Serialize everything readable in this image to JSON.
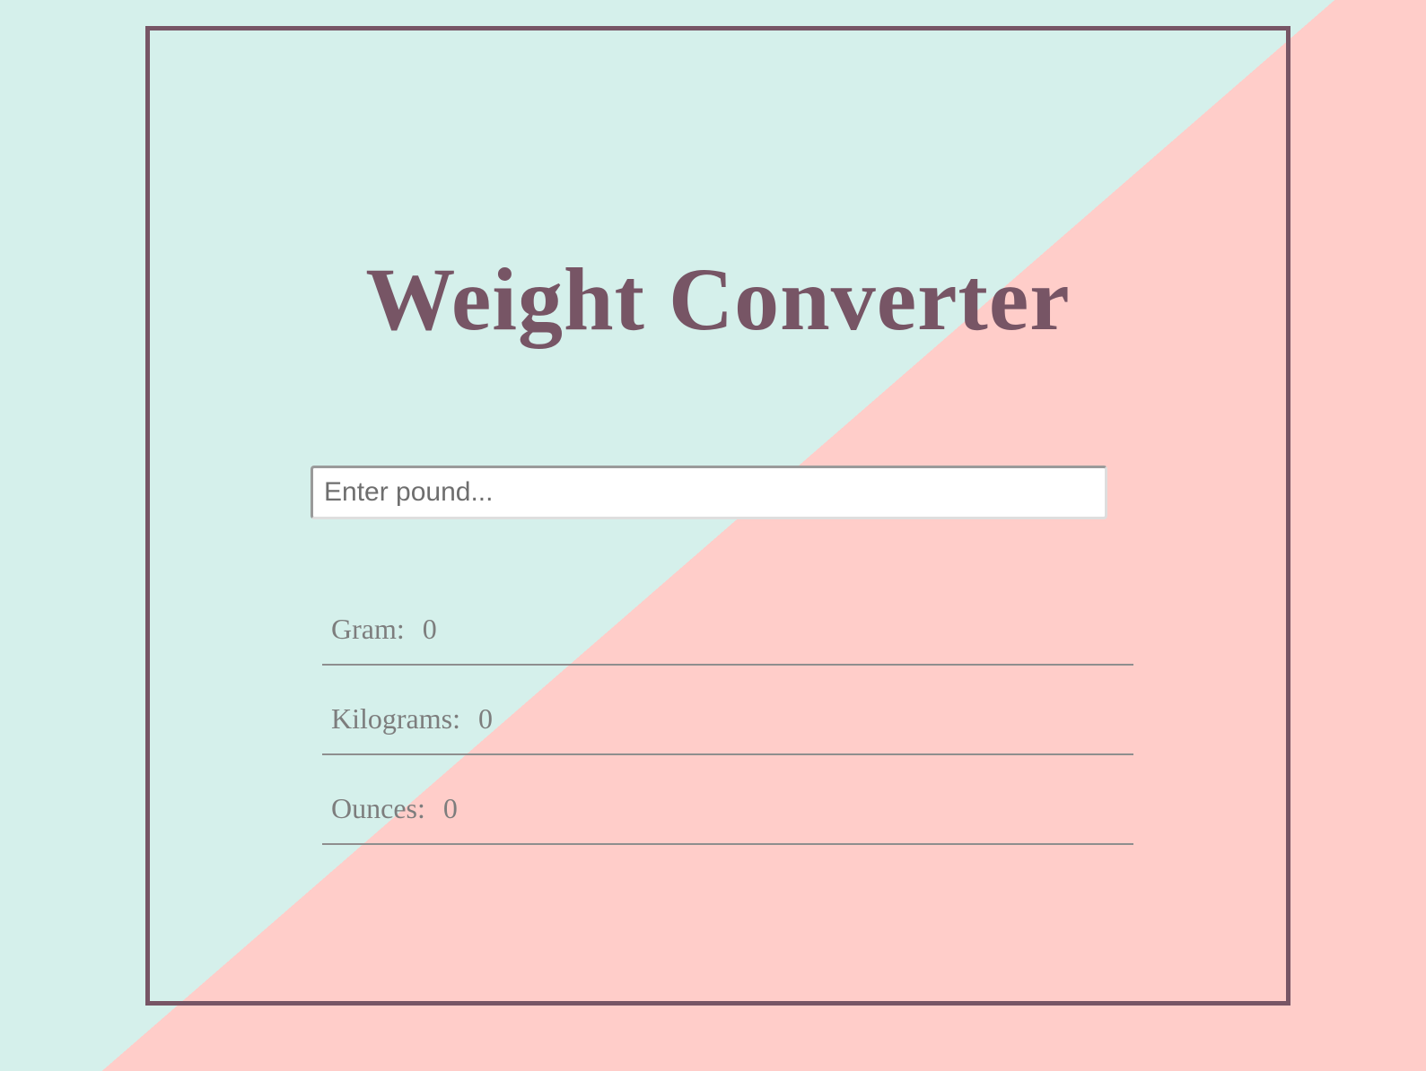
{
  "app": {
    "title": "Weight Converter"
  },
  "input": {
    "placeholder": "Enter pound...",
    "value": ""
  },
  "results": [
    {
      "label": "Gram:",
      "value": "0"
    },
    {
      "label": "Kilograms:",
      "value": "0"
    },
    {
      "label": "Ounces:",
      "value": "0"
    }
  ],
  "colors": {
    "accent": "#775565",
    "bg_mint": "#d5f0eb",
    "bg_pink": "#ffcdc9",
    "result_text": "#7d7d7d"
  }
}
